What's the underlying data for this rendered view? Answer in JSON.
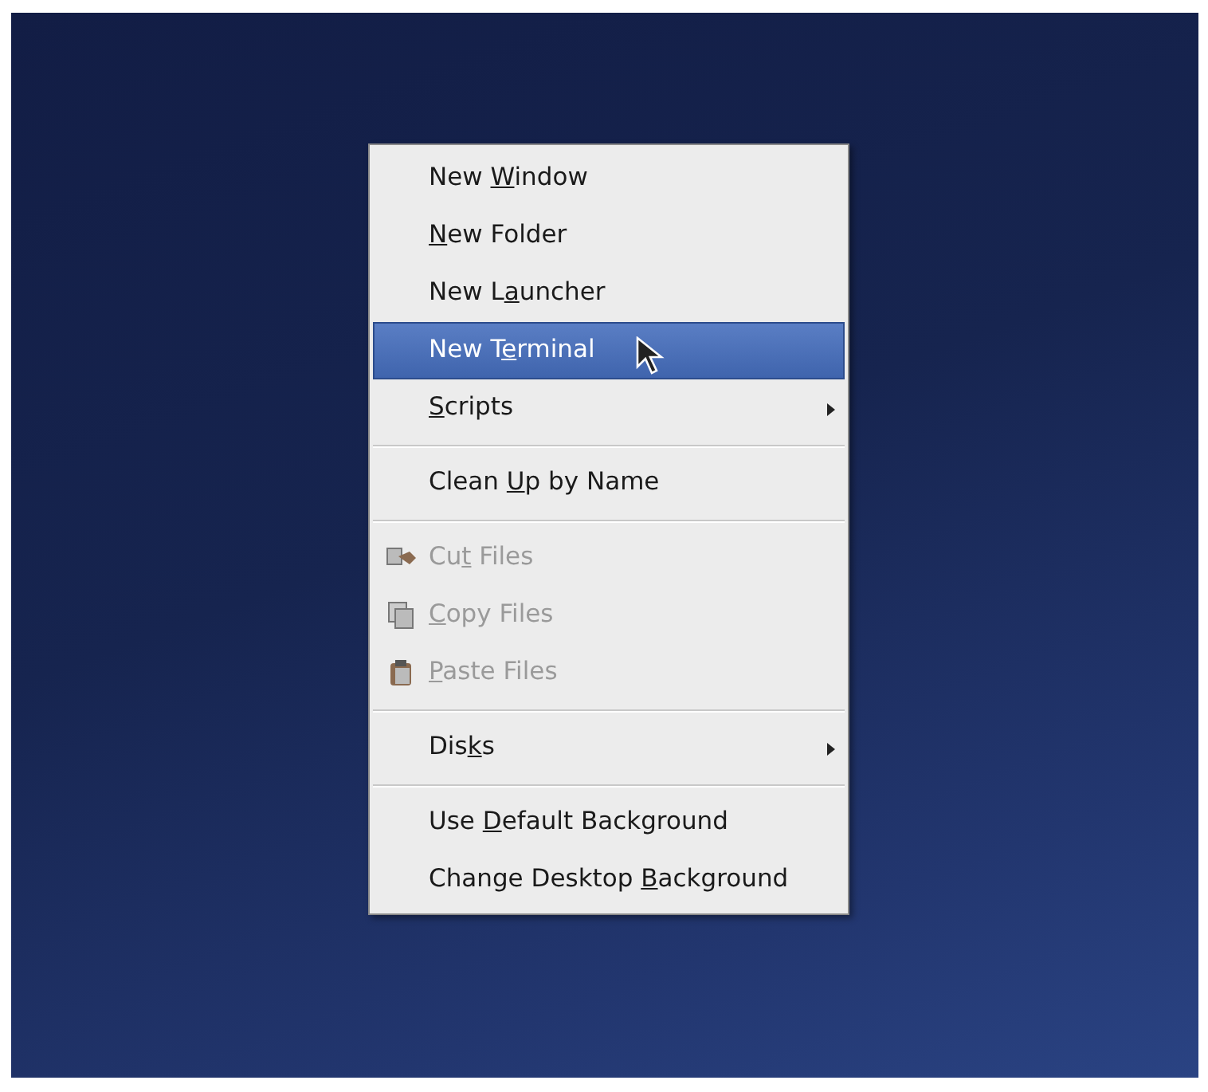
{
  "menu": {
    "entries": [
      {
        "kind": "item",
        "before": "New ",
        "key": "W",
        "after": "indow",
        "selected": false,
        "disabled": false,
        "submenu": false
      },
      {
        "kind": "item",
        "key": "N",
        "after": "ew Folder",
        "selected": false,
        "disabled": false,
        "submenu": false
      },
      {
        "kind": "item",
        "before": "New L",
        "key": "a",
        "after": "uncher",
        "selected": false,
        "disabled": false,
        "submenu": false
      },
      {
        "kind": "item",
        "before": "New T",
        "key": "e",
        "after": "rminal",
        "selected": true,
        "disabled": false,
        "submenu": false
      },
      {
        "kind": "item",
        "key": "S",
        "after": "cripts",
        "selected": false,
        "disabled": false,
        "submenu": true
      },
      {
        "kind": "separator"
      },
      {
        "kind": "item",
        "before": "Clean ",
        "key": "U",
        "after": "p by Name",
        "selected": false,
        "disabled": false,
        "submenu": false
      },
      {
        "kind": "separator"
      },
      {
        "kind": "item",
        "before": "Cu",
        "key": "t",
        "after": " Files",
        "selected": false,
        "disabled": true,
        "submenu": false
      },
      {
        "kind": "item",
        "key": "C",
        "after": "opy Files",
        "selected": false,
        "disabled": true,
        "submenu": false
      },
      {
        "kind": "item",
        "key": "P",
        "after": "aste Files",
        "selected": false,
        "disabled": true,
        "submenu": false
      },
      {
        "kind": "separator"
      },
      {
        "kind": "item",
        "before": "Dis",
        "key": "k",
        "after": "s",
        "selected": false,
        "disabled": false,
        "submenu": true
      },
      {
        "kind": "separator"
      },
      {
        "kind": "item",
        "before": "Use ",
        "key": "D",
        "after": "efault Background",
        "selected": false,
        "disabled": false,
        "submenu": false
      },
      {
        "kind": "item",
        "before": "Change Desktop ",
        "key": "B",
        "after": "ackground",
        "selected": false,
        "disabled": false,
        "submenu": false
      }
    ]
  }
}
